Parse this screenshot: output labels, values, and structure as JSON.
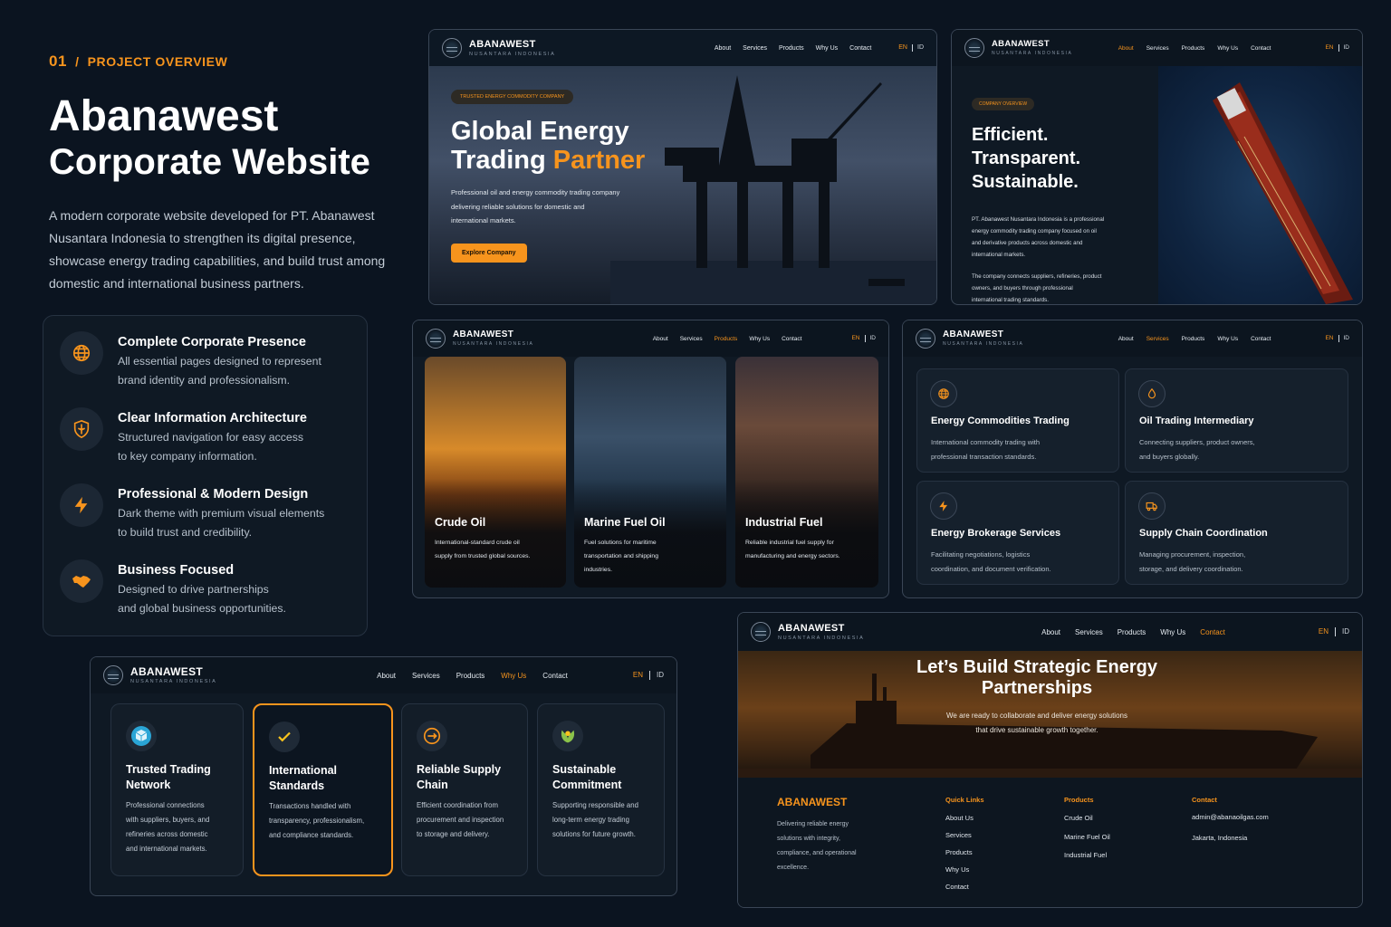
{
  "overview": {
    "number": "01",
    "section": "PROJECT OVERVIEW",
    "title_line1": "Abanawest",
    "title_line2": "Corporate Website",
    "description": "A modern corporate website developed for PT. Abanawest Nusantara Indonesia to strengthen its digital presence, showcase energy trading capabilities, and build trust among domestic and international business partners.",
    "features": [
      {
        "icon": "globe-icon",
        "title": "Complete Corporate Presence",
        "line1": "All essential pages designed to represent",
        "line2": "brand identity and professionalism."
      },
      {
        "icon": "shield-icon",
        "title": "Clear Information Architecture",
        "line1": "Structured navigation for easy access",
        "line2": "to key company information."
      },
      {
        "icon": "lightning-icon",
        "title": "Professional & Modern Design",
        "line1": "Dark theme with premium visual elements",
        "line2": "to build trust and credibility."
      },
      {
        "icon": "handshake-icon",
        "title": "Business Focused",
        "line1": "Designed to drive partnerships",
        "line2": "and global business opportunities."
      }
    ]
  },
  "site": {
    "brand": "ABANAWEST",
    "brand_sub": "NUSANTARA INDONESIA",
    "nav": [
      "About",
      "Services",
      "Products",
      "Why Us",
      "Contact"
    ],
    "lang_en": "EN",
    "lang_id": "ID"
  },
  "hero": {
    "badge": "TRUSTED ENERGY COMMODITY COMPANY",
    "title_line1": "Global Energy",
    "title_line2a": "Trading ",
    "title_line2b": "Partner",
    "desc_line1": "Professional oil and energy commodity trading company",
    "desc_line2": "delivering reliable solutions for domestic and",
    "desc_line3": "international markets.",
    "button": "Explore Company"
  },
  "about": {
    "badge": "COMPANY OVERVIEW",
    "title_line1": "Efficient.",
    "title_line2": "Transparent.",
    "title_line3": "Sustainable.",
    "p1_line1": "PT. Abanawest Nusantara Indonesia is a professional",
    "p1_line2": "energy commodity trading company focused on oil",
    "p1_line3": "and derivative products across domestic and",
    "p1_line4": "international markets.",
    "p2_line1": "The company connects suppliers, refineries, product",
    "p2_line2": "owners, and buyers through professional",
    "p2_line3": "international trading standards."
  },
  "products": [
    {
      "title": "Crude Oil",
      "line1": "International-standard crude oil",
      "line2": "supply from trusted global sources.",
      "line3": ""
    },
    {
      "title": "Marine Fuel Oil",
      "line1": "Fuel solutions for maritime",
      "line2": "transportation and shipping",
      "line3": "industries."
    },
    {
      "title": "Industrial Fuel",
      "line1": "Reliable industrial fuel supply for",
      "line2": "manufacturing and energy sectors.",
      "line3": ""
    }
  ],
  "services": [
    {
      "icon": "globe-icon",
      "title": "Energy Commodities Trading",
      "line1": "International commodity trading with",
      "line2": "professional transaction standards."
    },
    {
      "icon": "droplet-icon",
      "title": "Oil Trading Intermediary",
      "line1": "Connecting suppliers, product owners,",
      "line2": "and buyers globally."
    },
    {
      "icon": "lightning-icon",
      "title": "Energy Brokerage Services",
      "line1": "Facilitating negotiations, logistics",
      "line2": "coordination, and document verification."
    },
    {
      "icon": "truck-icon",
      "title": "Supply Chain Coordination",
      "line1": "Managing procurement, inspection,",
      "line2": "storage, and delivery coordination."
    }
  ],
  "whyus": [
    {
      "icon": "cube-icon",
      "title_line1": "Trusted Trading",
      "title_line2": "Network",
      "l1": "Professional connections",
      "l2": "with suppliers, buyers, and",
      "l3": "refineries across domestic",
      "l4": "and international markets."
    },
    {
      "icon": "check-icon",
      "title_line1": "International",
      "title_line2": "Standards",
      "l1": "Transactions handled with",
      "l2": "transparency, professionalism,",
      "l3": "and compliance standards.",
      "l4": ""
    },
    {
      "icon": "cycle-icon",
      "title_line1": "Reliable Supply",
      "title_line2": "Chain",
      "l1": "Efficient coordination from",
      "l2": "procurement and inspection",
      "l3": "to storage and delivery.",
      "l4": ""
    },
    {
      "icon": "leaf-icon",
      "title_line1": "Sustainable",
      "title_line2": "Commitment",
      "l1": "Supporting responsible and",
      "l2": "long-term energy trading",
      "l3": "solutions for future growth.",
      "l4": ""
    }
  ],
  "contact": {
    "title_line1": "Let’s Build Strategic Energy",
    "title_line2": "Partnerships",
    "desc_line1": "We are ready to collaborate and deliver energy solutions",
    "desc_line2": "that drive sustainable growth together.",
    "footer_brand": "ABANAWEST",
    "footer_desc": [
      "Delivering reliable energy",
      "solutions with integrity,",
      "compliance, and operational",
      "excellence."
    ],
    "quick_links_title": "Quick Links",
    "quick_links": [
      "About Us",
      "Services",
      "Products",
      "Why Us",
      "Contact"
    ],
    "products_title": "Products",
    "products": [
      "Crude Oil",
      "Marine Fuel Oil",
      "Industrial Fuel"
    ],
    "contact_title": "Contact",
    "email": "admin@abanaoilgas.com",
    "location": "Jakarta, Indonesia"
  },
  "colors": {
    "accent": "#f7941d",
    "background": "#0b1420",
    "panel": "#0f1924"
  }
}
